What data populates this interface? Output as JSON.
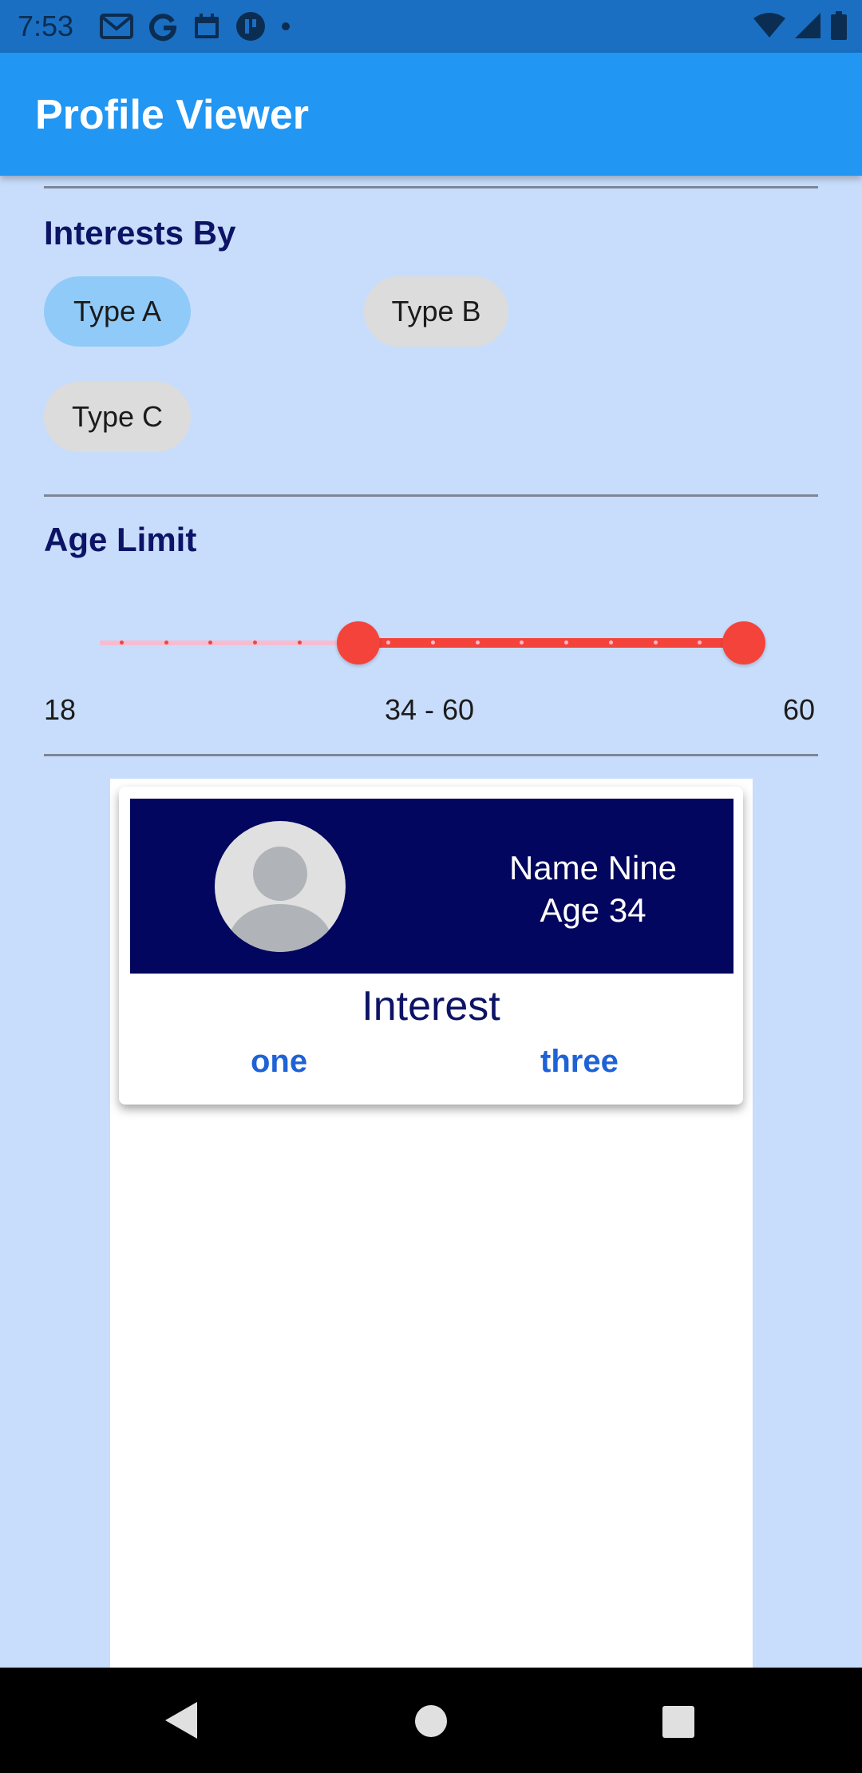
{
  "status_bar": {
    "time": "7:53",
    "left_icons": [
      "gmail-icon",
      "google-icon",
      "calendar-icon",
      "app-icon",
      "dot-icon"
    ],
    "right_icons": [
      "wifi-icon",
      "signal-icon",
      "battery-icon"
    ]
  },
  "app_bar": {
    "title": "Profile Viewer",
    "color": "#2196f3"
  },
  "interests": {
    "title": "Interests By",
    "chips": [
      {
        "label": "Type A",
        "selected": true
      },
      {
        "label": "Type B",
        "selected": false
      },
      {
        "label": "Type C",
        "selected": false
      }
    ]
  },
  "age_limit": {
    "title": "Age Limit",
    "min": 18,
    "max": 60,
    "selected_low": 34,
    "selected_high": 60,
    "min_label": "18",
    "max_label": "60",
    "range_label": "34 - 60",
    "active_color": "#f4433b",
    "inactive_color": "#f8bbd0"
  },
  "profiles": [
    {
      "name": "Name Nine",
      "age_text": "Age 34",
      "interest_title": "Interest",
      "interests": [
        "one",
        "three"
      ]
    }
  ],
  "nav_bar": {
    "buttons": [
      "back-icon",
      "home-icon",
      "recents-icon"
    ]
  }
}
